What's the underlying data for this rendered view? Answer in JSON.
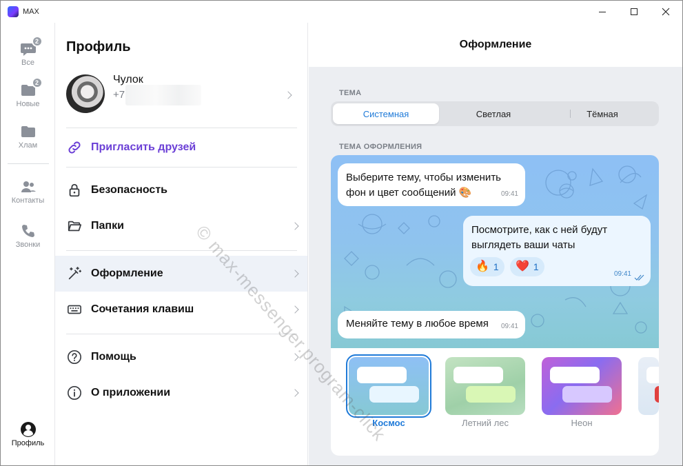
{
  "window": {
    "title": "MAX"
  },
  "rail": {
    "items": [
      {
        "label": "Все",
        "icon": "chat-bubble-icon",
        "badge": "2"
      },
      {
        "label": "Новые",
        "icon": "folder-icon",
        "badge": "2"
      },
      {
        "label": "Хлам",
        "icon": "folder-icon",
        "badge": ""
      },
      {
        "label": "Контакты",
        "icon": "contacts-icon",
        "badge": ""
      },
      {
        "label": "Звонки",
        "icon": "phone-icon",
        "badge": ""
      },
      {
        "label": "Профиль",
        "icon": "profile-icon",
        "badge": ""
      }
    ]
  },
  "profile": {
    "title": "Профиль",
    "user": {
      "name": "Чулок",
      "phone": "+7"
    },
    "menu": [
      {
        "label": "Пригласить друзей",
        "icon": "link-icon"
      },
      {
        "label": "Безопасность",
        "icon": "lock-icon"
      },
      {
        "label": "Папки",
        "icon": "folder-open-icon"
      },
      {
        "label": "Оформление",
        "icon": "magic-wand-icon",
        "active": true
      },
      {
        "label": "Сочетания клавиш",
        "icon": "keyboard-icon"
      },
      {
        "label": "Помощь",
        "icon": "help-icon"
      },
      {
        "label": "О приложении",
        "icon": "info-icon"
      }
    ]
  },
  "appearance": {
    "title": "Оформление",
    "theme_label": "ТЕМА",
    "theme_options": [
      "Системная",
      "Светлая",
      "Тёмная"
    ],
    "selected_theme": "Системная",
    "design_label": "ТЕМА ОФОРМЛЕНИЯ",
    "preview": {
      "msg1": {
        "text": "Выберите тему, чтобы изменить фон и цвет сообщений 🎨",
        "time": "09:41"
      },
      "msg2": {
        "text": "Посмотрите, как с ней будут выглядеть ваши чаты",
        "time": "09:41",
        "reactions": [
          {
            "emoji": "🔥",
            "count": "1"
          },
          {
            "emoji": "❤️",
            "count": "1"
          }
        ]
      },
      "msg3": {
        "text": "Меняйте тему в любое время",
        "time": "09:41"
      }
    },
    "designs": [
      {
        "name": "Космос",
        "selected": true
      },
      {
        "name": "Летний лес",
        "selected": false
      },
      {
        "name": "Неон",
        "selected": false
      }
    ]
  },
  "watermark": "© max-messenger.program-click",
  "colors": {
    "accent": "#1f7ad8",
    "invite": "#6b3fd6",
    "active_row": "#eef2f8"
  }
}
